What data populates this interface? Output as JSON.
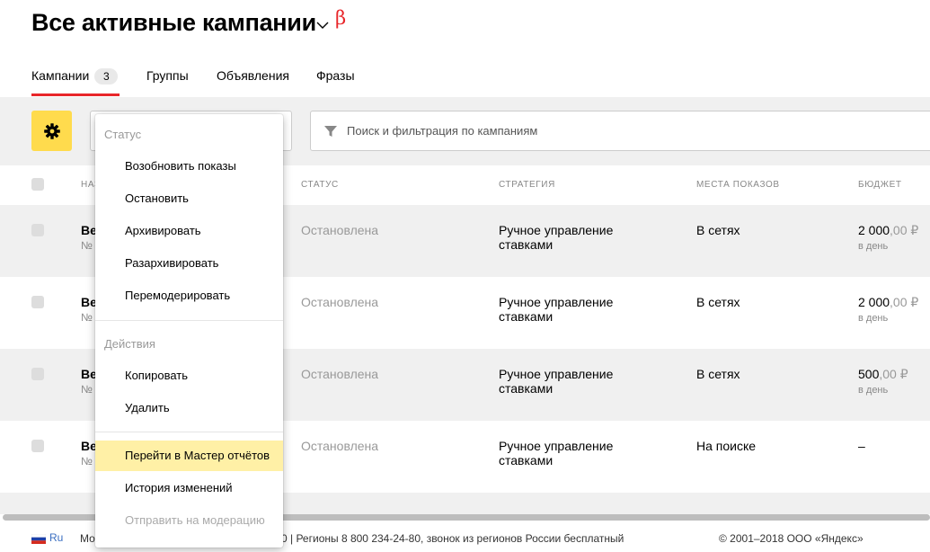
{
  "header": {
    "title": "Все активные кампании",
    "beta": "β"
  },
  "tabs": [
    {
      "label": "Кампании",
      "count": "3"
    },
    {
      "label": "Группы"
    },
    {
      "label": "Объявления"
    },
    {
      "label": "Фразы"
    }
  ],
  "search": {
    "placeholder": "Поиск и фильтрация по кампаниям"
  },
  "table": {
    "columns": {
      "name": "НАЗ",
      "status": "СТАТУС",
      "strategy": "СТРАТЕГИЯ",
      "places": "МЕСТА ПОКАЗОВ",
      "budget": "БЮДЖЕТ"
    },
    "rows": [
      {
        "name": "Ве",
        "number": "№",
        "status": "Остановлена",
        "strategy": "Ручное управление ставками",
        "places": "В сетях",
        "budget_int": "2 000",
        "budget_frac": ",00 ₽",
        "period": "в день"
      },
      {
        "name": "Ве",
        "number": "№",
        "status": "Остановлена",
        "strategy": "Ручное управление ставками",
        "places": "В сетях",
        "budget_int": "2 000",
        "budget_frac": ",00 ₽",
        "period": "в день"
      },
      {
        "name": "Ве",
        "number": "№",
        "status": "Остановлена",
        "strategy": "Ручное управление ставками",
        "places": "В сетях",
        "budget_int": "500",
        "budget_frac": ",00 ₽",
        "period": "в день"
      },
      {
        "name": "Ве",
        "number": "№",
        "status": "Остановлена",
        "strategy": "Ручное управление ставками",
        "places": "На поиске",
        "budget_int": "–",
        "budget_frac": "",
        "period": ""
      }
    ]
  },
  "dropdown": {
    "status_group": {
      "title": "Статус",
      "items": [
        "Возобновить показы",
        "Остановить",
        "Архивировать",
        "Разархивировать",
        "Перемодерировать"
      ]
    },
    "actions_group": {
      "title": "Действия",
      "items": [
        "Копировать",
        "Удалить"
      ]
    },
    "extra_items": [
      "Перейти в Мастер отчётов",
      "История изменений",
      "Отправить на модерацию"
    ]
  },
  "footer": {
    "lang": "Ru",
    "left": "Мо",
    "contacts": "0 | Регионы 8 800 234-24-80, звонок из регионов России бесплатный",
    "copyright": "© 2001–2018  ООО «Яндекс»"
  },
  "colors": {
    "accent_yellow": "#ffdb4d",
    "tab_underline": "#e8262a",
    "highlight": "#fff0a6"
  }
}
